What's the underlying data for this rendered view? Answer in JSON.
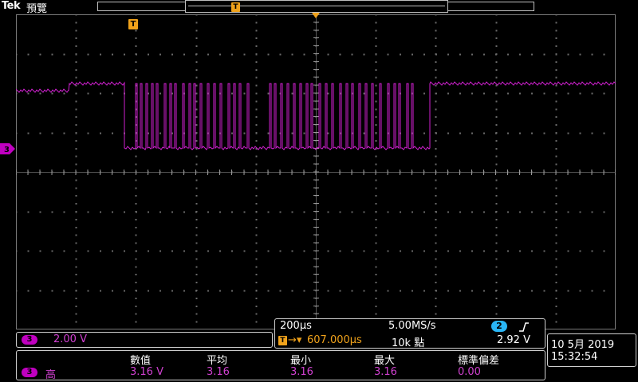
{
  "header": {
    "brand": "Tek",
    "mode": "預覽",
    "record_trigger_glyph": "T"
  },
  "trigger_marker_glyph": "T",
  "ch3_marker_label": "3",
  "channel3": {
    "badge": "3",
    "scale": "2.00 V",
    "color": "#d020d0"
  },
  "timebase": {
    "time_per_div": "200µs",
    "sample_rate": "5.00MS/s",
    "trigger_position": "607.000µs",
    "record_length": "10k 點",
    "trigger_source_badge": "2",
    "trigger_slope_icon": "rising-edge-icon",
    "trigger_level": "2.92 V"
  },
  "datetime": {
    "date": "10 5月  2019",
    "time": "15:32:54"
  },
  "measurements": {
    "headers": [
      "數值",
      "平均",
      "最小",
      "最大",
      "標準偏差"
    ],
    "row": {
      "channel_badge": "3",
      "name": "高",
      "values": [
        "3.16 V",
        "3.16",
        "3.16",
        "3.16",
        "0.00"
      ]
    }
  },
  "colors": {
    "channel3": "#d020d0",
    "trigger": "#f0a21b",
    "channel2": "#29b6f6",
    "grid": "#6a6a6a"
  }
}
